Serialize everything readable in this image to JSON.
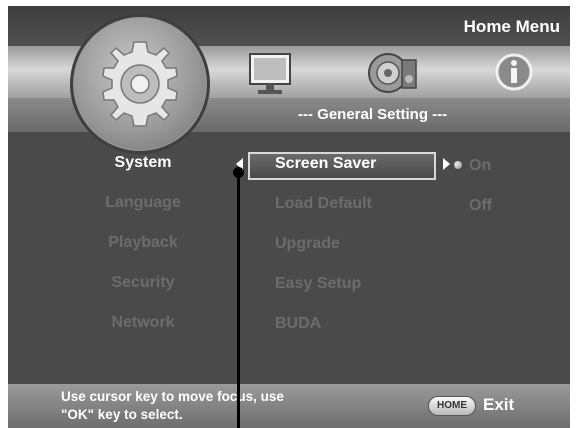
{
  "header": {
    "title": "Home Menu",
    "section_title": "--- General Setting ---",
    "icons": [
      "gear-icon",
      "monitor-icon",
      "speaker-icon",
      "info-icon"
    ]
  },
  "menu": {
    "categories": [
      "System",
      "Language",
      "Playback",
      "Security",
      "Network"
    ],
    "active_category": "System",
    "settings": [
      "Screen Saver",
      "Load Default",
      "Upgrade",
      "Easy Setup",
      "BUDA"
    ],
    "active_setting": "Screen Saver",
    "options": [
      "On",
      "Off"
    ],
    "selected_option": "On"
  },
  "footer": {
    "hint": "Use cursor key to move focus, use \"OK\" key to select.",
    "hint_line1": "Use cursor key to move focus, use",
    "hint_line2": "\"OK\" key to select.",
    "home_key": "HOME",
    "exit_label": "Exit"
  },
  "colors": {
    "background": "#4a4a4a",
    "active_text": "#ffffff",
    "inactive_text": "#6c6c6c"
  }
}
